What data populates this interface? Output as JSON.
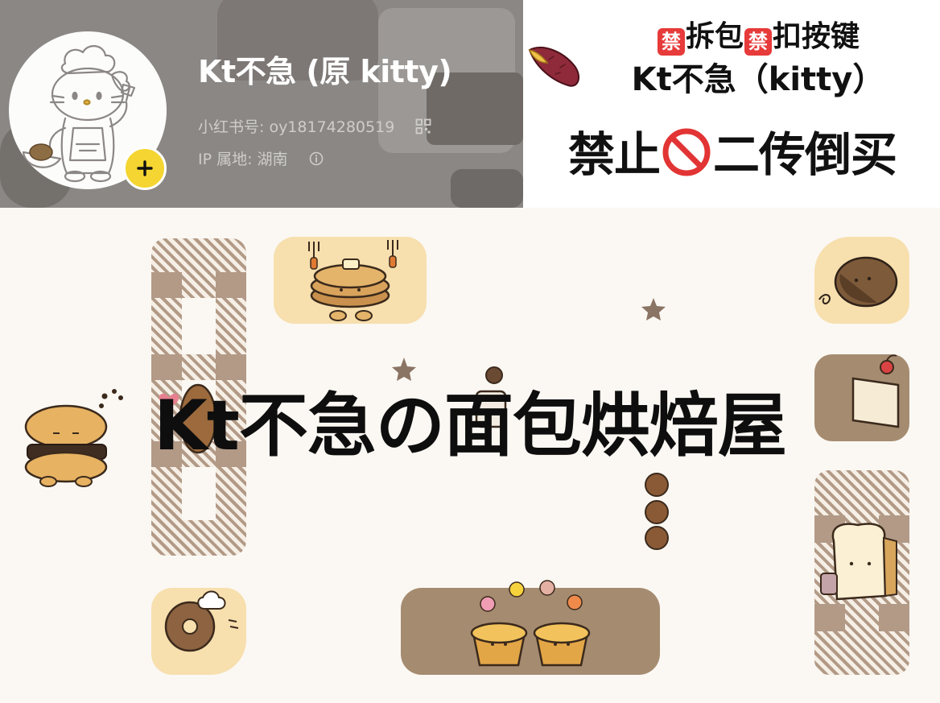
{
  "profile": {
    "display_name": "Kt不急 (原 kitty)",
    "id_label": "小红书号: oy18174280519",
    "ip_label": "IP 属地: 湖南",
    "follow_button": "+"
  },
  "notice": {
    "line1_part1": "禁",
    "line1_part2": "拆包",
    "line1_part3": "禁",
    "line1_part4": "扣按键",
    "line2": "Kt不急（kitty）",
    "line3_part1": "禁止",
    "line3_part2": "二传倒买"
  },
  "banner": {
    "title": "Kt不急の面包烘焙屋"
  },
  "icons": {
    "qr": "qr-code-icon",
    "info": "info-icon",
    "no_entry": "no-entry-icon",
    "sweet_potato": "sweet-potato-icon"
  },
  "colors": {
    "header_bg": "#8a8784",
    "follow_yellow": "#f4d531",
    "ban_red": "#e73a3a",
    "tile_light": "#f7dfae",
    "tile_dark": "#a58b70",
    "page_bg": "#fbf8f3"
  }
}
